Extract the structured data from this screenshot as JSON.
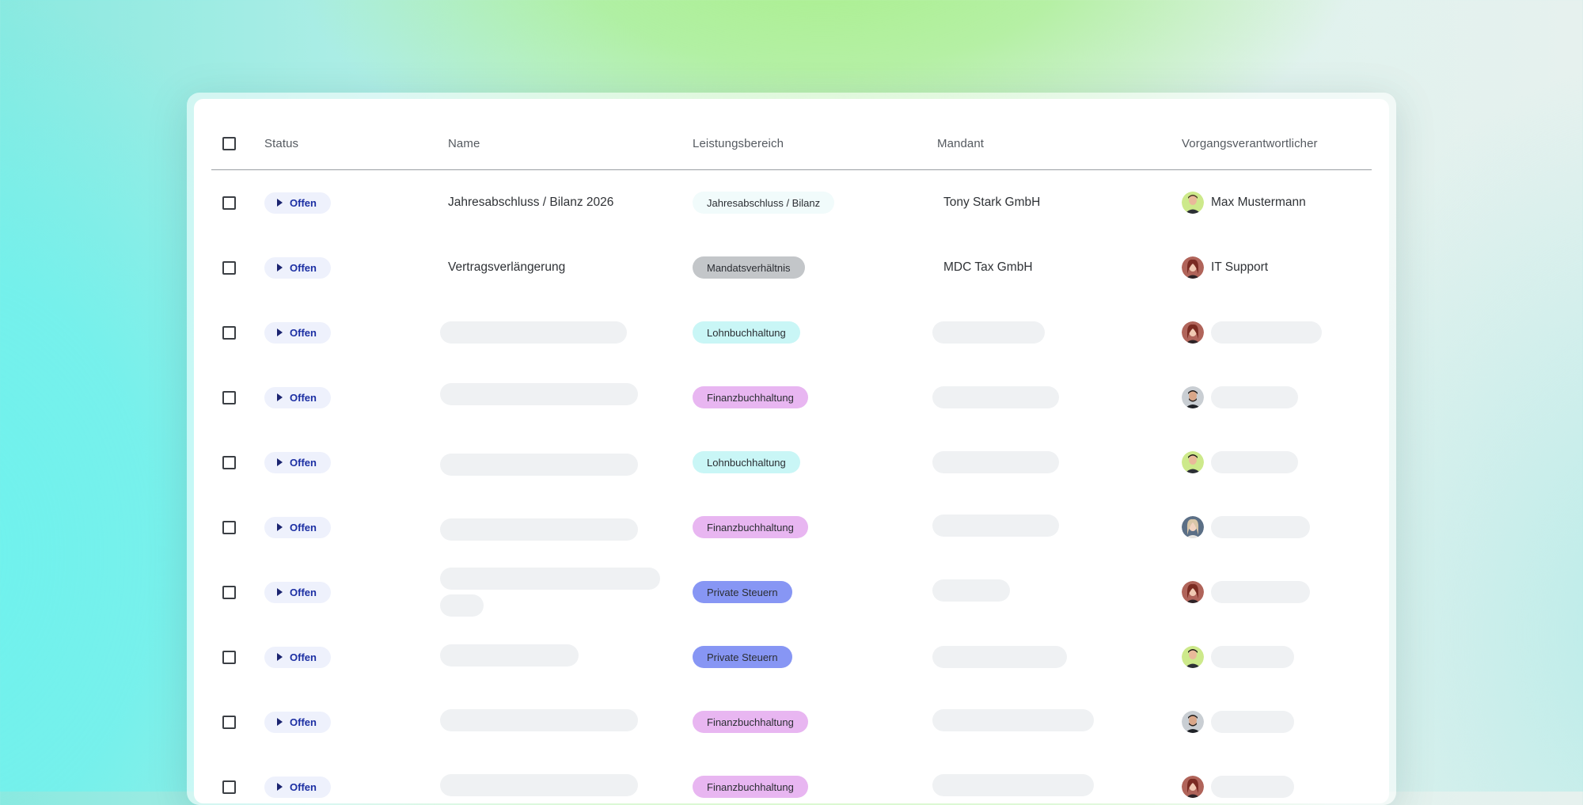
{
  "colors": {
    "status_pill_bg": "#eef1fc",
    "status_text": "#1c2fa3",
    "skeleton": "#eff1f3"
  },
  "table": {
    "headers": {
      "status": "Status",
      "name": "Name",
      "area": "Leistungsbereich",
      "client": "Mandant",
      "owner": "Vorgangsverantwortlicher"
    },
    "rows": [
      {
        "status": "Offen",
        "name": "Jahresabschluss / Bilanz 2026",
        "area": "Jahresabschluss / Bilanz",
        "area_color": "#f1fbfb",
        "client": "Tony Stark GmbH",
        "owner": "Max Mustermann",
        "avatar": "avatar-man-green"
      },
      {
        "status": "Offen",
        "name": "Vertragsverlängerung",
        "area": "Mandatsverhältnis",
        "area_color": "#c3c6c9",
        "client": "MDC Tax GmbH",
        "owner": "IT Support",
        "avatar": "avatar-woman-red"
      },
      {
        "status": "Offen",
        "area": "Lohnbuchhaltung",
        "area_color": "#c9f6f6",
        "avatar": "avatar-woman-red"
      },
      {
        "status": "Offen",
        "area": "Finanzbuchhaltung",
        "area_color": "#e8b6f1",
        "avatar": "avatar-man-dark"
      },
      {
        "status": "Offen",
        "area": "Lohnbuchhaltung",
        "area_color": "#c9f6f6",
        "avatar": "avatar-man-green"
      },
      {
        "status": "Offen",
        "area": "Finanzbuchhaltung",
        "area_color": "#e8b6f1",
        "avatar": "avatar-woman-blonde"
      },
      {
        "status": "Offen",
        "area": "Private Steuern",
        "area_color": "#8796f4",
        "avatar": "avatar-woman-red"
      },
      {
        "status": "Offen",
        "area": "Private Steuern",
        "area_color": "#8796f4",
        "avatar": "avatar-man-green"
      },
      {
        "status": "Offen",
        "area": "Finanzbuchhaltung",
        "area_color": "#e8b6f1",
        "avatar": "avatar-man-dark"
      },
      {
        "status": "Offen",
        "area": "Finanzbuchhaltung",
        "area_color": "#e8b6f1",
        "avatar": "avatar-woman-red"
      }
    ]
  }
}
